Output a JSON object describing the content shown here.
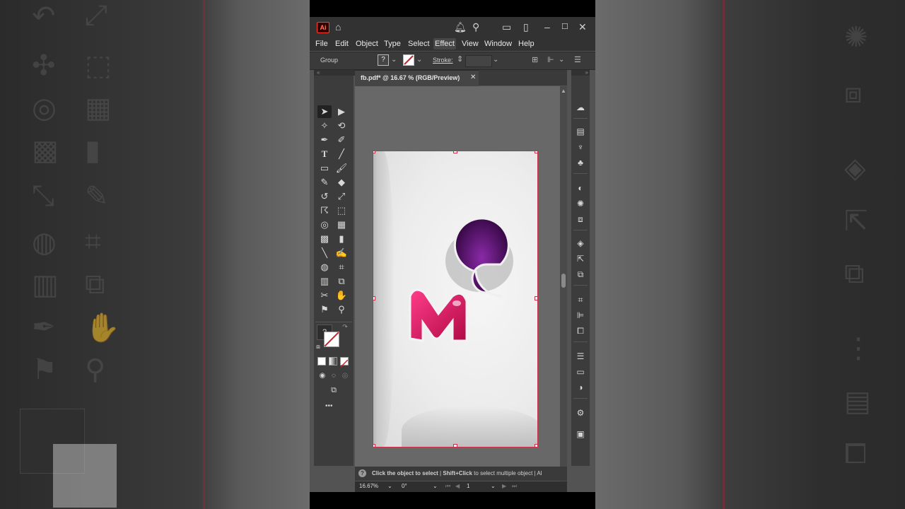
{
  "titlebar": {
    "app_logo": "Ai",
    "icons": [
      "home-icon",
      "notification-icon",
      "search-icon",
      "workspace-icon",
      "arrange-icon",
      "minimize-icon",
      "maximize-icon",
      "close-icon"
    ]
  },
  "menu": [
    "File",
    "Edit",
    "Object",
    "Type",
    "Select",
    "Effect",
    "View",
    "Window",
    "Help"
  ],
  "active_menu": "Effect",
  "control_bar": {
    "selection": "Group",
    "fill_label": "?",
    "stroke_label": "Stroke:"
  },
  "document": {
    "tab_title": "fb.pdf* @ 16.67 % (RGB/Preview)",
    "close_glyph": "✕"
  },
  "status": {
    "help": "?",
    "hint_bold_1": "Click the object to select",
    "separator": "|",
    "hint_bold_2": "Shift+Click",
    "hint_rest": "to select multiple object",
    "hint_trail": "| Al"
  },
  "zoom_bar": {
    "zoom": "16.67%",
    "rotation": "0°",
    "artboard": "1"
  },
  "tools_panel": {
    "fill_stroke_label": "?",
    "more": "•••"
  },
  "colors": {
    "accent": "#ff3d2e",
    "artboard_outline": "#c8304a",
    "logo_pink": "#e0246a",
    "logo_purple": "#4a0a5e"
  }
}
